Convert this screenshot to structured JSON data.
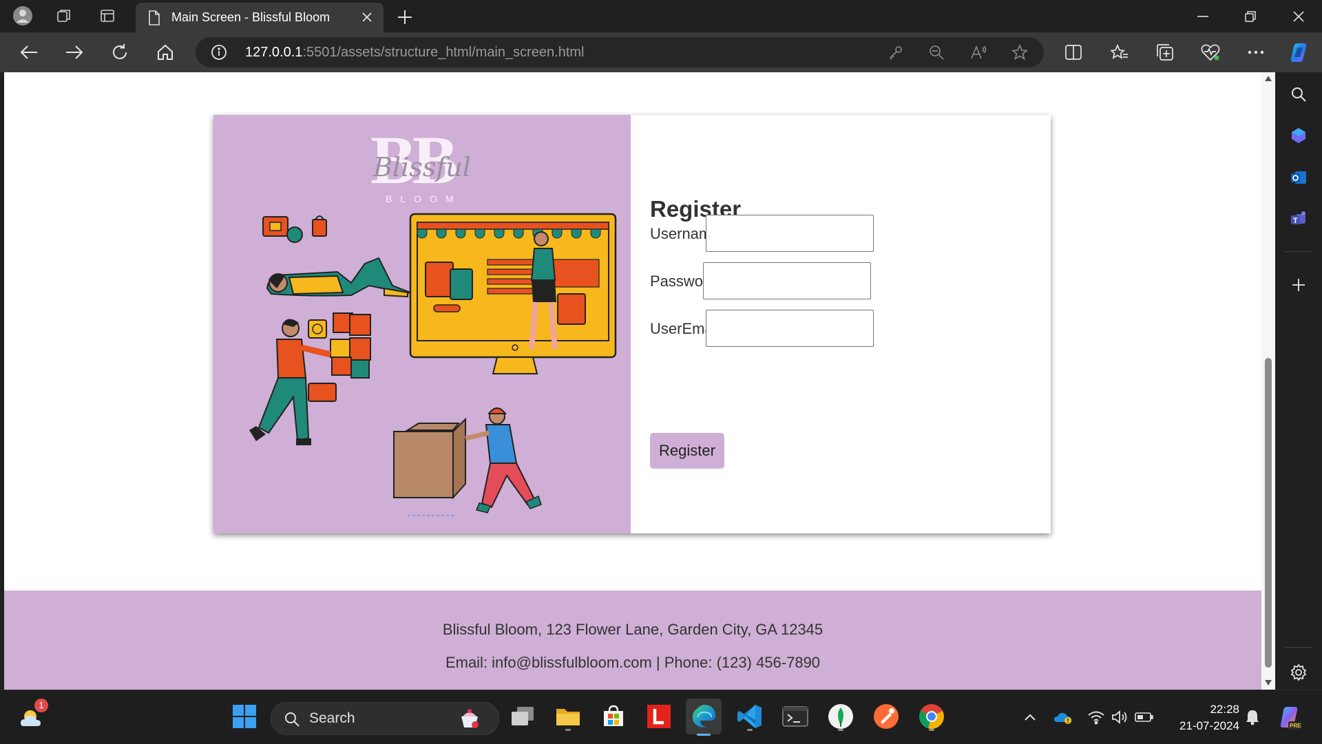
{
  "browser": {
    "tab_title": "Main Screen - Blissful Bloom",
    "url_host": "127.0.0.1",
    "url_rest": ":5501/assets/structure_html/main_screen.html"
  },
  "logo": {
    "letters": "BB",
    "script": "Blissful",
    "sub": "BLOOM"
  },
  "form": {
    "title": "Register",
    "username_label": "Username:",
    "password_label": "Password:",
    "email_label": "UserEmail:",
    "username_value": "",
    "password_value": "",
    "email_value": "",
    "button_label": "Register"
  },
  "footer": {
    "address": "Blissful Bloom, 123 Flower Lane, Garden City, GA 12345",
    "contact": "Email: info@blissfulbloom.com | Phone: (123) 456-7890"
  },
  "taskbar": {
    "search_label": "Search",
    "weather_badge": "1",
    "time": "22:28",
    "date": "21-07-2024"
  },
  "colors": {
    "accent_lilac": "#cfafd5",
    "browser_dark": "#202020"
  }
}
